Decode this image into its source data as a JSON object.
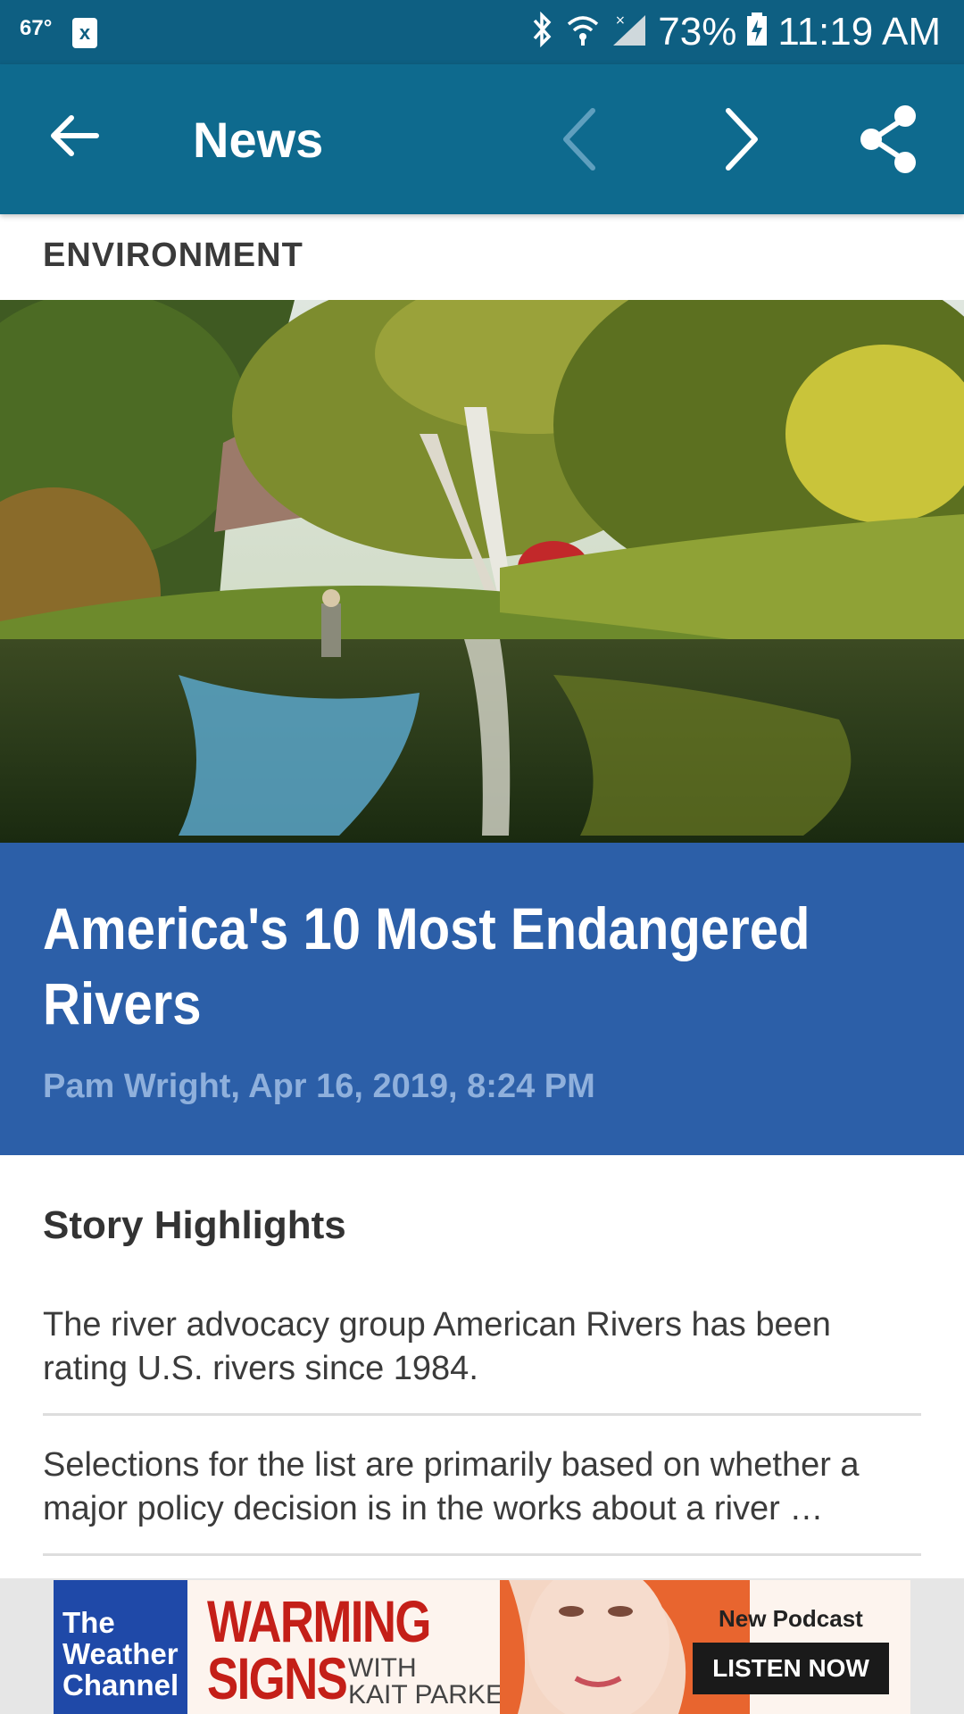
{
  "status": {
    "temperature": "67°",
    "notification_glyph": "x",
    "battery": "73%",
    "time": "11:19 AM"
  },
  "toolbar": {
    "title": "News"
  },
  "article": {
    "section": "ENVIRONMENT",
    "headline": "America's 10 Most Endangered Rivers",
    "byline": "Pam Wright, Apr 16, 2019, 8:24 PM",
    "highlights_title": "Story Highlights",
    "highlights": [
      "The river advocacy group American Rivers has been rating U.S. rivers since 1984.",
      "Selections for the list are primarily based on whether a major policy decision is in the works about a river …"
    ]
  },
  "ad": {
    "brand": "The Weather Channel",
    "title_line1": "WARMING",
    "title_line2": "SIGNS",
    "with_text": "WITH",
    "host": "KAIT PARKER",
    "tagline": "New Podcast",
    "cta": "LISTEN NOW"
  },
  "colors": {
    "status_bar": "#0e5f82",
    "toolbar": "#0e6a8e",
    "headline_box": "#2c5fa8",
    "byline": "#8fb0dc"
  },
  "icons": [
    "back-arrow-icon",
    "chevron-left-icon",
    "chevron-right-icon",
    "share-icon",
    "bluetooth-icon",
    "wifi-icon",
    "cell-signal-icon",
    "battery-charging-icon"
  ]
}
